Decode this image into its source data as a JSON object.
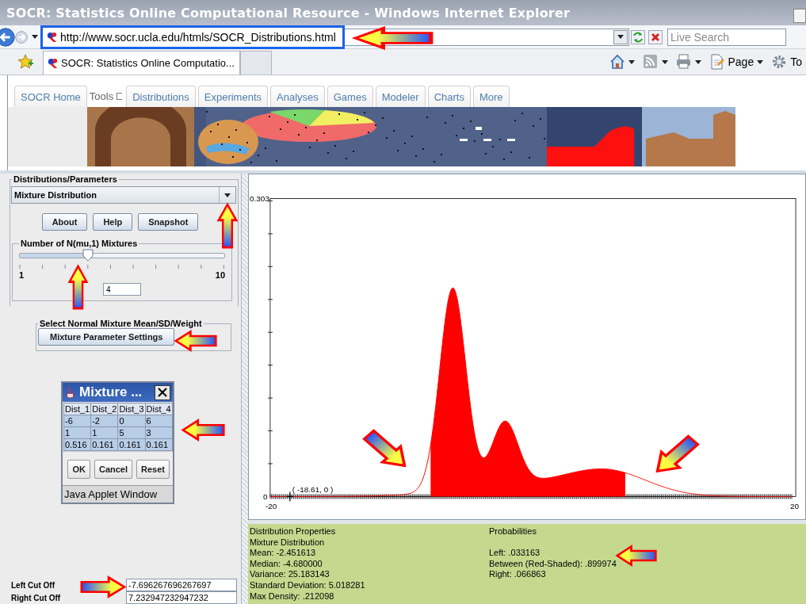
{
  "window": {
    "title": "SOCR: Statistics Online Computational Resource - Windows Internet Explorer"
  },
  "address_bar": {
    "url": "http://www.socr.ucla.edu/htmls/SOCR_Distributions.html",
    "highlighted": true,
    "callout": {
      "kind": "left"
    }
  },
  "search": {
    "placeholder": "Live Search"
  },
  "browser_tabs": [
    {
      "label": "SOCR: Statistics Online Computatio...",
      "selected": true
    }
  ],
  "command_bar": [
    {
      "kind": "home"
    },
    {
      "kind": "feeds"
    },
    {
      "kind": "print"
    },
    {
      "kind": "page",
      "label": "Page"
    },
    {
      "kind": "tools",
      "label": "To"
    }
  ],
  "site_tabs": [
    {
      "kind": "tab",
      "label": "SOCR Home"
    },
    {
      "kind": "menu",
      "label": "Tools"
    },
    {
      "kind": "tab",
      "label": "Distributions"
    },
    {
      "kind": "tab",
      "label": "Experiments"
    },
    {
      "kind": "tab",
      "label": "Analyses"
    },
    {
      "kind": "tab",
      "label": "Games"
    },
    {
      "kind": "tab",
      "label": "Modeler"
    },
    {
      "kind": "tab",
      "label": "Charts"
    },
    {
      "kind": "tab",
      "label": "More"
    }
  ],
  "parameters": {
    "group_title": "Distributions/Parameters",
    "distribution": "Mixture Distribution",
    "dropdown_callout": {
      "kind": "up"
    },
    "buttons": [
      "About",
      "Help",
      "Snapshot"
    ]
  },
  "slider": {
    "title": "Number of N(mu,1) Mixtures",
    "min_label": "1",
    "max_label": "10",
    "level": 0.333,
    "value": "4",
    "callout": {
      "kind": "up"
    }
  },
  "mixture_settings": {
    "group_title": "Select Normal Mixture Mean/SD/Weight",
    "button": "Mixture Parameter Settings",
    "callout": {
      "kind": "left"
    }
  },
  "mixture_window": {
    "title": "Mixture ...",
    "columns": [
      "Dist_1",
      "Dist_2",
      "Dist_3",
      "Dist_4"
    ],
    "rows": [
      [
        "-6",
        "-2",
        "0",
        "6"
      ],
      [
        "1",
        "1",
        "5",
        "3"
      ],
      [
        "0.516",
        "0.161",
        "0.161",
        "0.161"
      ]
    ],
    "buttons": [
      "OK",
      "Cancel",
      "Reset"
    ],
    "status": "Java Applet Window",
    "callout": {
      "kind": "left"
    }
  },
  "cut_offs": [
    {
      "label": "Left Cut Off",
      "value": "-7.696267696267697",
      "callout": {
        "kind": "right"
      }
    },
    {
      "label": "Right Cut Off",
      "value": "7.232947232947232"
    }
  ],
  "plot": {
    "y_max_label": "0.303",
    "y_min_label": "0",
    "x_min_label": "-20",
    "x_max_label": "20",
    "cursor_label": "( -18.61, 0 )",
    "left_callout": {
      "kind": "down-right"
    },
    "right_callout": {
      "kind": "down-left"
    }
  },
  "properties": {
    "title": "Distribution Properties",
    "lines": [
      "Mixture Distribution",
      "Mean: -2.451613",
      "Median: -4.680000",
      "Variance: 25.183143",
      "Standard Deviation: 5.018281",
      "Max Density: .212098"
    ]
  },
  "probabilities": {
    "title": "Probabilities",
    "lines": [
      {
        "text": "Left: .033163"
      },
      {
        "text": "Between (Red-Shaded): .899974",
        "callout": {
          "kind": "left"
        }
      },
      {
        "text": "Right: .066863"
      }
    ]
  }
}
